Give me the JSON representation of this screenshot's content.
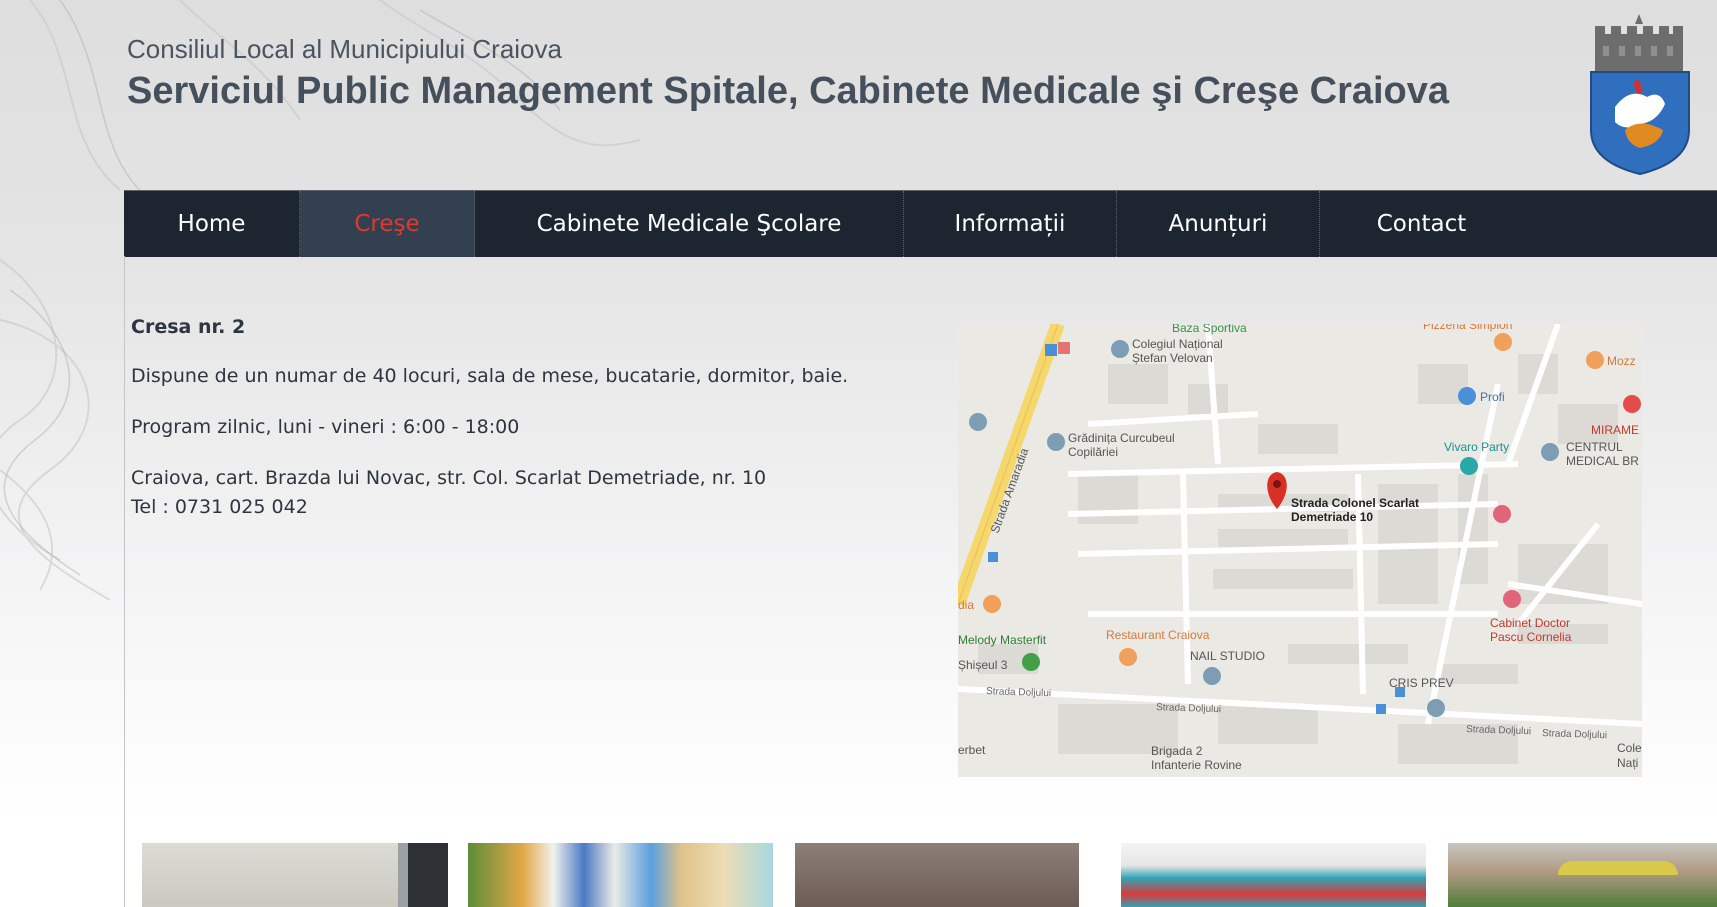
{
  "header": {
    "council": "Consiliul Local al Municipiului Craiova",
    "title": "Serviciul Public Management Spitale, Cabinete Medicale şi Creşe Craiova",
    "crest_icon": "craiova-coat-of-arms-icon"
  },
  "nav": {
    "items": [
      {
        "label": "Home"
      },
      {
        "label": "Creşe",
        "active": true
      },
      {
        "label": "Cabinete Medicale Şcolare"
      },
      {
        "label": "Informații"
      },
      {
        "label": "Anunțuri"
      },
      {
        "label": "Contact"
      }
    ],
    "active_color": "#e0392b",
    "bar_color": "#1d2530"
  },
  "content": {
    "name": "Cresa nr. 2",
    "capacity": "Dispune de un numar de 40 locuri, sala de mese, bucatarie, dormitor, baie.",
    "program": "Program zilnic, luni - vineri : 6:00 - 18:00",
    "address": "Craiova, cart. Brazda lui Novac, str. Col. Scarlat Demetriade, nr. 10",
    "phone": "Tel : 0731 025 042"
  },
  "map": {
    "pin_label_1": "Strada Colonel Scarlat",
    "pin_label_2": "Demetriade 10",
    "labels": {
      "baza": "Baza Sportiva",
      "colegiu1": "Colegiul Național",
      "colegiu2": "Ștefan Velovan",
      "pizzeria": "Pizzeria Simplon",
      "mozz": "Mozz",
      "profi": "Profi",
      "mirame": "MIRAME",
      "gradinita1": "Grădinița Curcubeul",
      "gradinita2": "Copilăriei",
      "vivaro": "Vivaro Party",
      "centrul1": "CENTRUL",
      "centrul2": "MEDICAL BR",
      "amaradia": "Strada Amaradia",
      "dia": "dia",
      "cabinet1": "Cabinet Doctor",
      "cabinet2": "Pascu Cornelia",
      "melody": "Melody Masterfit",
      "shiseul": "Șhișeul 3",
      "restaurant": "Restaurant Craiova",
      "nail": "NAIL STUDIO",
      "cris": "CRIS PREV",
      "doljului1": "Strada Doljului",
      "doljului2": "Strada Doljului",
      "doljului3": "Strada Doljului",
      "doljului4": "Strada Doljului",
      "berbet": "erbet",
      "brigada1": "Brigada 2",
      "brigada2": "Infanterie Rovine",
      "col1": "Cole",
      "col2": "Nați"
    }
  }
}
